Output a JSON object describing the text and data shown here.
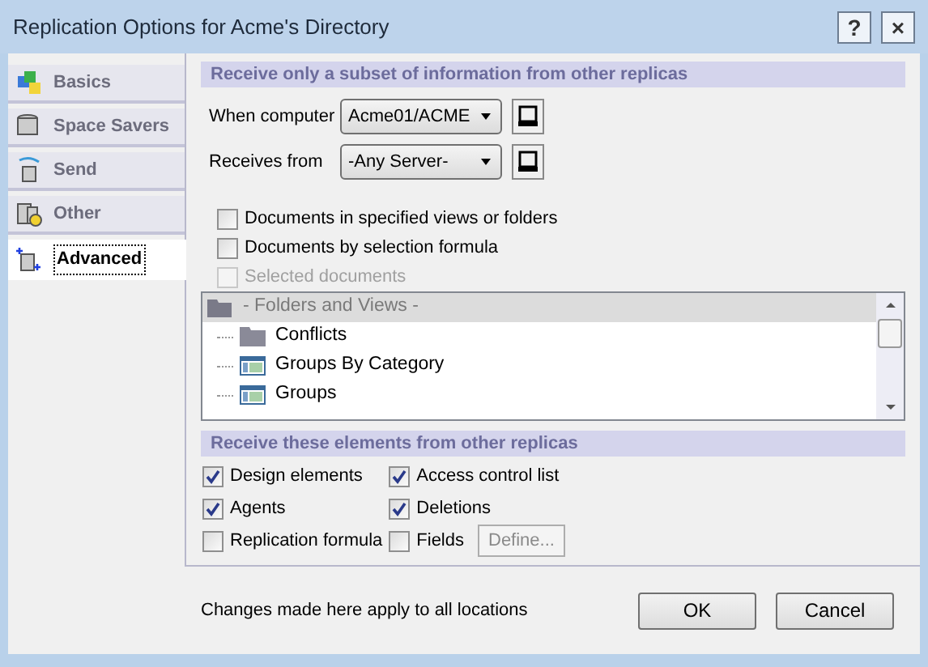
{
  "window": {
    "title": "Replication Options for Acme's Directory",
    "buttons": [
      "?",
      "×"
    ]
  },
  "tabs": [
    {
      "label": "Basics",
      "selected": false
    },
    {
      "label": "Space Savers",
      "selected": false
    },
    {
      "label": "Send",
      "selected": false
    },
    {
      "label": "Other",
      "selected": false
    },
    {
      "label": "Advanced",
      "selected": true
    }
  ],
  "subset": {
    "heading": "Receive only a subset of information from other replicas",
    "fields": [
      {
        "label": "When computer",
        "value": "Acme01/ACME"
      },
      {
        "label": "Receives from",
        "value": "-Any Server-"
      }
    ],
    "options": [
      {
        "label": "Documents in specified views or folders",
        "checked": false,
        "disabled": false
      },
      {
        "label": "Documents by selection formula",
        "checked": false,
        "disabled": false
      },
      {
        "label": "Selected documents",
        "checked": false,
        "disabled": true
      }
    ],
    "tree": {
      "root": "- Folders and Views -",
      "children": [
        {
          "label": "Conflicts",
          "kind": "folder"
        },
        {
          "label": "Groups By Category",
          "kind": "view"
        },
        {
          "label": "Groups",
          "kind": "view"
        }
      ]
    }
  },
  "elements": {
    "heading": "Receive these elements from other replicas",
    "options": [
      {
        "label": "Design elements",
        "checked": true
      },
      {
        "label": "Access control list",
        "checked": true
      },
      {
        "label": "Agents",
        "checked": true
      },
      {
        "label": "Deletions",
        "checked": true
      },
      {
        "label": "Replication formula",
        "checked": false
      },
      {
        "label": "Fields",
        "checked": false
      }
    ],
    "define_button": "Define..."
  },
  "footer": {
    "note": "Changes made here apply to all locations",
    "buttons": [
      "OK",
      "Cancel"
    ]
  }
}
